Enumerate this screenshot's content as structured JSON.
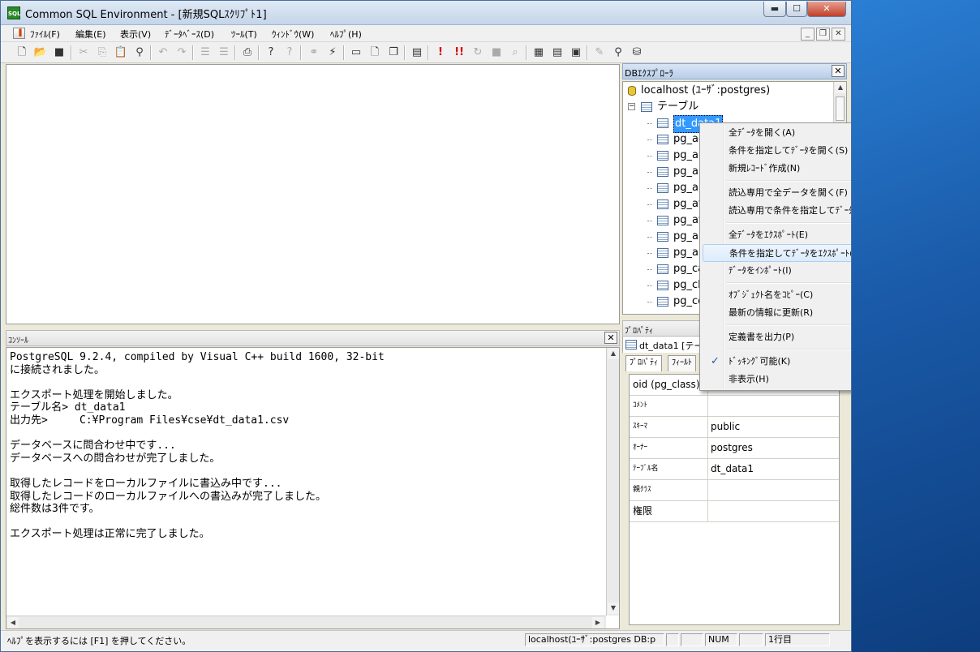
{
  "window": {
    "title": "Common SQL Environment - [新規SQLｽｸﾘﾌﾟﾄ1]",
    "app_icon_text": "SQL",
    "min": "▬",
    "max": "☐",
    "close": "✕"
  },
  "menubar": {
    "items": [
      "ﾌｧｲﾙ(F)",
      "編集(E)",
      "表示(V)",
      "ﾃﾞｰﾀﾍﾞｰｽ(D)",
      "ﾂｰﾙ(T)",
      "ｳｨﾝﾄﾞｳ(W)",
      "ﾍﾙﾌﾟ(H)"
    ],
    "mdi_min": "_",
    "mdi_restore": "❐",
    "mdi_close": "✕"
  },
  "toolbar": {
    "icons": [
      "new-file-icon",
      "open-folder-icon",
      "save-icon",
      "cut-icon",
      "copy-icon",
      "paste-icon",
      "find-icon",
      "undo-icon",
      "redo-icon",
      "indent-icon",
      "outdent-icon",
      "print-icon",
      "help-icon",
      "context-help-icon",
      "connect-icon",
      "disconnect-icon",
      "window-icon",
      "new-window-icon",
      "cascade-icon",
      "script-icon",
      "execute-icon",
      "execute-all-icon",
      "step-icon",
      "stop-icon",
      "explain-icon",
      "table-view-icon",
      "grid-icon",
      "form-icon",
      "tools-icon",
      "search-icon",
      "object-icon"
    ]
  },
  "console": {
    "title": "ｺﾝｿｰﾙ",
    "lines": [
      "PostgreSQL 9.2.4, compiled by Visual C++ build 1600, 32-bit",
      "に接続されました。",
      "",
      "エクスポート処理を開始しました。",
      "テーブル名> dt_data1",
      "出力先>     C:¥Program Files¥cse¥dt_data1.csv",
      "",
      "データベースに問合わせ中です...",
      "データベースへの問合わせが完了しました。",
      "",
      "取得したレコードをローカルファイルに書込み中です...",
      "取得したレコードのローカルファイルへの書込みが完了しました。",
      "総件数は3件です。",
      "",
      "エクスポート処理は正常に完了しました。"
    ]
  },
  "db_explorer": {
    "title": "DBｴｸｽﾌﾟﾛｰﾗ",
    "server": "localhost (ﾕｰｻﾞ:postgres)",
    "tables_node": "テーブル",
    "tables": [
      "dt_data1",
      "pg_ag",
      "pg_ar",
      "pg_ar",
      "pg_ar",
      "pg_at",
      "pg_at",
      "pg_au",
      "pg_au",
      "pg_ca",
      "pg_cl",
      "pg_co"
    ]
  },
  "properties": {
    "title": "ﾌﾟﾛﾊﾟﾃｨ",
    "header": "dt_data1 [テー",
    "tabs": [
      "ﾌﾟﾛﾊﾟﾃｨ",
      "ﾌｨｰﾙﾄ"
    ],
    "rows": [
      {
        "key": "oid (pg_class)",
        "value": ""
      },
      {
        "key": "ｺﾒﾝﾄ",
        "value": ""
      },
      {
        "key": "ｽｷｰﾏ",
        "value": "public"
      },
      {
        "key": "ｵｰﾅｰ",
        "value": "postgres"
      },
      {
        "key": "ﾃｰﾌﾞﾙ名",
        "value": "dt_data1"
      },
      {
        "key": "親ｸﾗｽ",
        "value": ""
      },
      {
        "key": "権限",
        "value": ""
      }
    ]
  },
  "context_menu": {
    "items": [
      {
        "label": "全ﾃﾞｰﾀを開く(A)"
      },
      {
        "label": "条件を指定してﾃﾞｰﾀを開く(S)"
      },
      {
        "label": "新規ﾚｺｰﾄﾞ作成(N)"
      },
      {
        "label": "読込専用で全データを開く(F)"
      },
      {
        "label": "読込専用で条件を指定してﾃﾞｰﾀを開く(L)"
      },
      {
        "label": "全ﾃﾞｰﾀをｴｸｽﾎﾟｰﾄ(E)"
      },
      {
        "label": "条件を指定してﾃﾞｰﾀをｴｸｽﾎﾟｰﾄ(X)"
      },
      {
        "label": "ﾃﾞｰﾀをｲﾝﾎﾟｰﾄ(I)"
      },
      {
        "label": "ｵﾌﾞｼﾞｪｸﾄ名をｺﾋﾟｰ(C)"
      },
      {
        "label": "最新の情報に更新(R)"
      },
      {
        "label": "定義書を出力(P)"
      },
      {
        "label": "ﾄﾞｯｷﾝｸﾞ可能(K)"
      },
      {
        "label": "非表示(H)"
      }
    ],
    "highlighted_index": 6,
    "checked_index": 11
  },
  "statusbar": {
    "message": "ﾍﾙﾌﾟを表示するには [F1] を押してください。",
    "connection": "localhost(ﾕｰｻﾞ:postgres DB:p",
    "num": "NUM",
    "line": "1行目"
  }
}
